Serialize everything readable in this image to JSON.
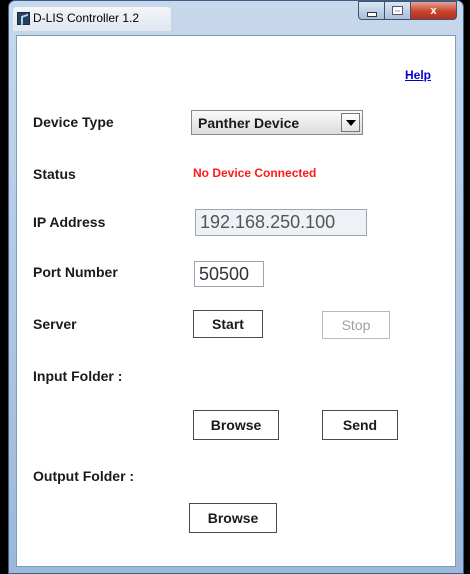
{
  "window": {
    "title": "D-LIS Controller 1.2",
    "icon": "app-icon"
  },
  "caption_buttons": {
    "minimize": "minimize-icon",
    "maximize": "maximize-icon",
    "close": "x"
  },
  "help_link": "Help",
  "device_type": {
    "label": "Device Type",
    "selected": "Panther Device"
  },
  "status": {
    "label": "Status",
    "value": "No Device Connected",
    "color": "#ff1a1a"
  },
  "ip_address": {
    "label": "IP Address",
    "value": "192.168.250.100"
  },
  "port_number": {
    "label": "Port Number",
    "value": "50500"
  },
  "server": {
    "label": "Server",
    "start_label": "Start",
    "stop_label": "Stop"
  },
  "input_folder": {
    "label": "Input Folder :",
    "browse_label": "Browse",
    "send_label": "Send"
  },
  "output_folder": {
    "label": "Output Folder :",
    "browse_label": "Browse"
  }
}
